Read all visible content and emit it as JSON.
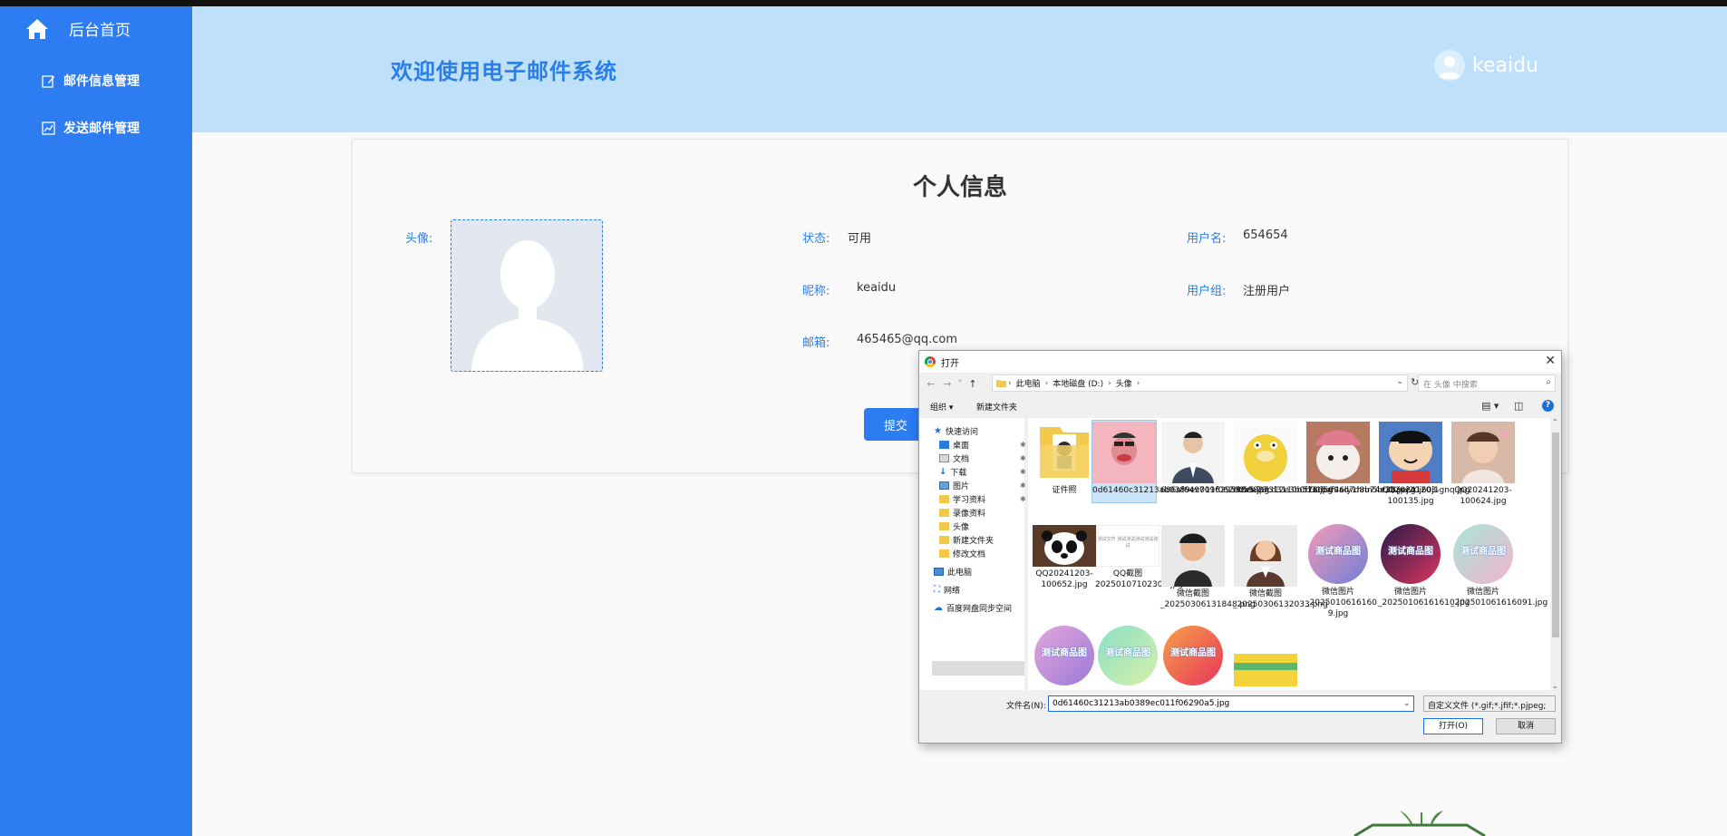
{
  "sidebar": {
    "home_label": "后台首页",
    "items": [
      {
        "label": "邮件信息管理",
        "icon": "edit-icon"
      },
      {
        "label": "发送邮件管理",
        "icon": "chart-icon"
      }
    ]
  },
  "header": {
    "title": "欢迎使用电子邮件系统",
    "username": "keaidu"
  },
  "profile": {
    "title": "个人信息",
    "avatar_label": "头像:",
    "status_label": "状态:",
    "status_value": "可用",
    "username_label": "用户名:",
    "username_value": "654654",
    "nickname_label": "昵称:",
    "nickname_value": "keaidu",
    "group_label": "用户组:",
    "group_value": "注册用户",
    "email_label": "邮箱:",
    "email_value": "465465@qq.com",
    "submit_label": "提交"
  },
  "dialog": {
    "title": "打开",
    "breadcrumb": [
      "此电脑",
      "本地磁盘 (D:)",
      "头像"
    ],
    "search_placeholder": "在 头像 中搜索",
    "organize_label": "组织 ▾",
    "new_folder_label": "新建文件夹",
    "nav": [
      {
        "label": "快速访问",
        "icon": "star-icon",
        "pinned": false
      },
      {
        "label": "桌面",
        "icon": "desktop-icon",
        "pinned": true
      },
      {
        "label": "文档",
        "icon": "document-icon",
        "pinned": true
      },
      {
        "label": "下载",
        "icon": "download-icon",
        "pinned": true
      },
      {
        "label": "图片",
        "icon": "picture-icon",
        "pinned": true
      },
      {
        "label": "学习资料",
        "icon": "folder-icon",
        "pinned": true
      },
      {
        "label": "录像资料",
        "icon": "folder-icon",
        "pinned": false
      },
      {
        "label": "头像",
        "icon": "folder-icon",
        "pinned": false
      },
      {
        "label": "新建文件夹",
        "icon": "folder-icon",
        "pinned": false
      },
      {
        "label": "修改文档",
        "icon": "folder-icon",
        "pinned": false
      },
      {
        "label": "此电脑",
        "icon": "computer-icon",
        "pinned": false
      },
      {
        "label": "网络",
        "icon": "network-icon",
        "pinned": false
      },
      {
        "label": "百度网盘同步空间",
        "icon": "cloud-icon",
        "pinned": false
      }
    ],
    "files": [
      {
        "name": "证件照",
        "kind": "folder"
      },
      {
        "name": "0d61460c31213ab0389ec011f06290a5.jpg",
        "kind": "image",
        "selected": true
      },
      {
        "name": "686af649709629598ea78cd3110b51a.jpg",
        "kind": "image"
      },
      {
        "name": "cb59827312e3b0f786509ad7d8b74e3b.jpeg",
        "kind": "image"
      },
      {
        "name": "d315af46ly1hnn5bt28pej20j60j1gnq.jpg",
        "kind": "image"
      },
      {
        "name": "QQ20241203-100135.jpg",
        "kind": "image"
      },
      {
        "name": "QQ20241203-100624.jpg",
        "kind": "image"
      },
      {
        "name": "QQ20241203-100652.jpg",
        "kind": "image"
      },
      {
        "name": "QQ截图20250107102301.jpg",
        "kind": "image",
        "thumb_text": "测试文件\n测试测试测试测试测试"
      },
      {
        "name": "微信截图_20250306131848.png",
        "kind": "image"
      },
      {
        "name": "微信截图_20250306132033.png",
        "kind": "image"
      },
      {
        "name": "微信图片_2025010616160 9.jpg",
        "kind": "image",
        "thumb_text": "测试商品图"
      },
      {
        "name": "微信图片_20250106161610.jpg",
        "kind": "image",
        "thumb_text": "测试商品图"
      },
      {
        "name": "微信图片_202501061616091.jpg",
        "kind": "image",
        "thumb_text": "测试商品图"
      },
      {
        "name": "",
        "kind": "image",
        "thumb_text": "测试商品图"
      },
      {
        "name": "",
        "kind": "image",
        "thumb_text": "测试商品图"
      },
      {
        "name": "",
        "kind": "image",
        "thumb_text": "测试商品图"
      },
      {
        "name": "",
        "kind": "image"
      }
    ],
    "filename_label": "文件名(N):",
    "filename_value": "0d61460c31213ab0389ec011f06290a5.jpg",
    "filetype_value": "自定义文件 (*.gif;*.jfif;*.pjpeg;",
    "open_label": "打开(O)",
    "cancel_label": "取消"
  }
}
